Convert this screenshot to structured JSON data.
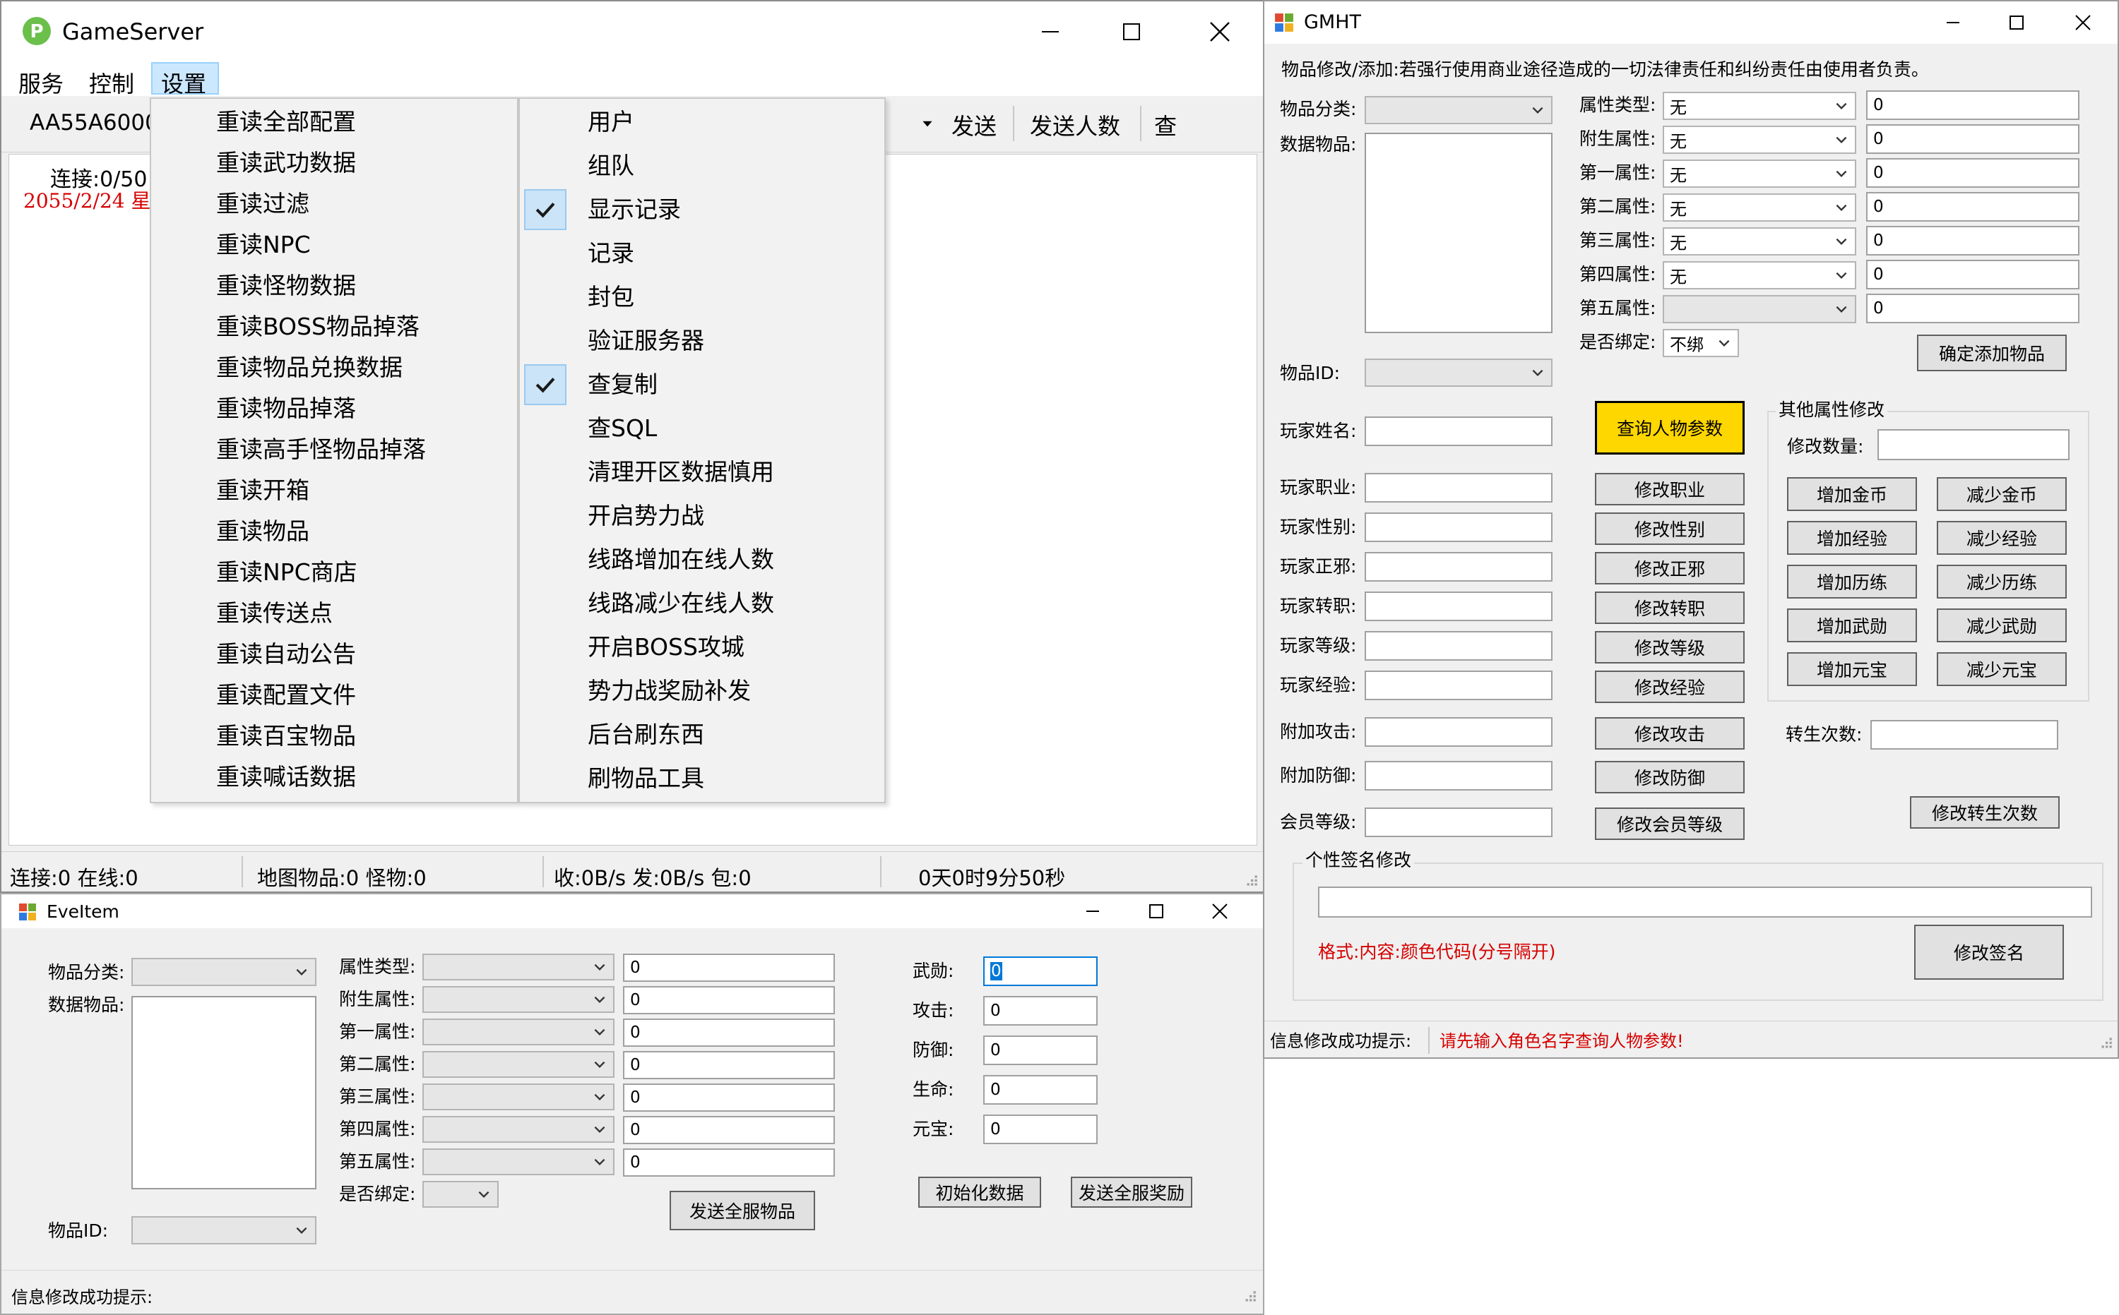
{
  "gameserver": {
    "title": "GameServer",
    "menubar": [
      "服务",
      "控制",
      "设置"
    ],
    "toolbar": {
      "input_value": "AA55A6000",
      "send": "发送",
      "send_count": "发送人数",
      "query": "查"
    },
    "log": {
      "connection": "连接:0/50",
      "date": "2055/2/24 星"
    },
    "settings_menu_col1": [
      "重读全部配置",
      "重读武功数据",
      "重读过滤",
      "重读NPC",
      "重读怪物数据",
      "重读BOSS物品掉落",
      "重读物品兑换数据",
      "重读物品掉落",
      "重读高手怪物品掉落",
      "重读开箱",
      "重读物品",
      "重读NPC商店",
      "重读传送点",
      "重读自动公告",
      "重读配置文件",
      "重读百宝物品",
      "重读喊话数据"
    ],
    "settings_menu_col2": [
      "用户",
      "组队",
      "显示记录",
      "记录",
      "封包",
      "验证服务器",
      "查复制",
      "查SQL",
      "清理开区数据慎用",
      "开启势力战",
      "线路增加在线人数",
      "线路减少在线人数",
      "开启BOSS攻城",
      "势力战奖励补发",
      "后台刷东西",
      "刷物品工具"
    ],
    "status": {
      "conn": "连接:0 在线:0",
      "map": "地图物品:0 怪物:0",
      "io": "收:0B/s 发:0B/s 包:0",
      "uptime": "0天0时9分50秒"
    }
  },
  "eveitem": {
    "title": "EveItem",
    "labels": {
      "category": "物品分类:",
      "data_items": "数据物品:",
      "item_id": "物品ID:",
      "attr_type": "属性类型:",
      "sub_attr": "附生属性:",
      "attr1": "第一属性:",
      "attr2": "第二属性:",
      "attr3": "第三属性:",
      "attr4": "第四属性:",
      "attr5": "第五属性:",
      "bound": "是否绑定:",
      "wuxun": "武勋:",
      "attack": "攻击:",
      "defense": "防御:",
      "life": "生命:",
      "yuanbao": "元宝:",
      "status": "信息修改成功提示:"
    },
    "values": {
      "attr_type": "0",
      "sub_attr": "0",
      "attr1": "0",
      "attr2": "0",
      "attr3": "0",
      "attr4": "0",
      "attr5": "0",
      "wuxun": "0",
      "attack": "0",
      "defense": "0",
      "life": "0",
      "yuanbao": "0"
    },
    "buttons": {
      "send_all_items": "发送全服物品",
      "init_data": "初始化数据",
      "send_all_rewards": "发送全服奖励"
    }
  },
  "gmht": {
    "title": "GMHT",
    "notice": "物品修改/添加:若强行使用商业途径造成的一切法律责任和纠纷责任由使用者负责。",
    "labels": {
      "category": "物品分类:",
      "data_items": "数据物品:",
      "item_id": "物品ID:",
      "attr_type": "属性类型:",
      "sub_attr": "附生属性:",
      "attr1": "第一属性:",
      "attr2": "第二属性:",
      "attr3": "第三属性:",
      "attr4": "第四属性:",
      "attr5": "第五属性:",
      "bound": "是否绑定:",
      "player_name": "玩家姓名:",
      "player_job": "玩家职业:",
      "player_gender": "玩家性别:",
      "player_align": "玩家正邪:",
      "player_rebirth": "玩家转职:",
      "player_level": "玩家等级:",
      "player_exp": "玩家经验:",
      "extra_attack": "附加攻击:",
      "extra_defense": "附加防御:",
      "vip_level": "会员等级:",
      "other_group": "其他属性修改",
      "modify_amount": "修改数量:",
      "reincarnation": "转生次数:",
      "signature_group": "个性签名修改",
      "status": "信息修改成功提示:"
    },
    "combo_values": {
      "attr_type": "无",
      "sub_attr": "无",
      "attr1": "无",
      "attr2": "无",
      "attr3": "无",
      "attr4": "无",
      "bound": "不绑"
    },
    "values": {
      "attr_type": "0",
      "sub_attr": "0",
      "attr1": "0",
      "attr2": "0",
      "attr3": "0",
      "attr4": "0",
      "attr5": "0"
    },
    "buttons": {
      "confirm_add": "确定添加物品",
      "query_player": "查询人物参数",
      "mod_job": "修改职业",
      "mod_gender": "修改性别",
      "mod_align": "修改正邪",
      "mod_rebirth": "修改转职",
      "mod_level": "修改等级",
      "mod_exp": "修改经验",
      "mod_attack": "修改攻击",
      "mod_defense": "修改防御",
      "mod_vip": "修改会员等级",
      "add_gold": "增加金币",
      "sub_gold": "减少金币",
      "add_exp": "增加经验",
      "sub_exp": "减少经验",
      "add_training": "增加历练",
      "sub_training": "减少历练",
      "add_wuxun": "增加武勋",
      "sub_wuxun": "减少武勋",
      "add_yuanbao": "增加元宝",
      "sub_yuanbao": "减少元宝",
      "mod_reincarnation": "修改转生次数",
      "mod_signature": "修改签名"
    },
    "format_hint": "格式:内容:颜色代码(分号隔开)",
    "status_message": "请先输入角色名字查询人物参数!"
  },
  "colors": {
    "menu_highlight": "#cce8ff",
    "check_bg": "#cce4f7",
    "query_button": "#ffd700",
    "red_text": "#d60000"
  }
}
